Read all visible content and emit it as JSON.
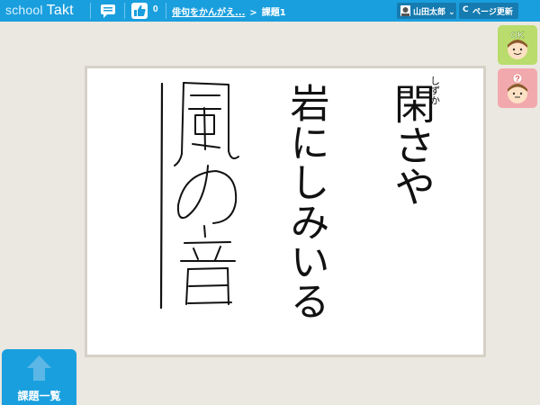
{
  "header": {
    "logo_school": "school",
    "logo_takt": "Takt",
    "like_count": "0",
    "breadcrumb": {
      "assignment": "俳句をかんがえ...",
      "separator": ">",
      "current": "課題1"
    },
    "user_name": "山田太郎",
    "user_chevron": "⌄",
    "refresh_label": "ページ更新",
    "refresh_icon": "C"
  },
  "reactions": {
    "ok_label": "OK",
    "question_label": "?"
  },
  "sheet": {
    "columns": [
      {
        "text": "閑さや",
        "ruby": "しずか"
      },
      {
        "text": "岩にしみいる"
      },
      {
        "text": "風の音",
        "handwritten": true
      }
    ]
  },
  "footer": {
    "list_label": "課題一覧"
  },
  "colors": {
    "accent": "#1a9fde",
    "ok": "#b9dc6c",
    "question": "#f2a9ad"
  }
}
